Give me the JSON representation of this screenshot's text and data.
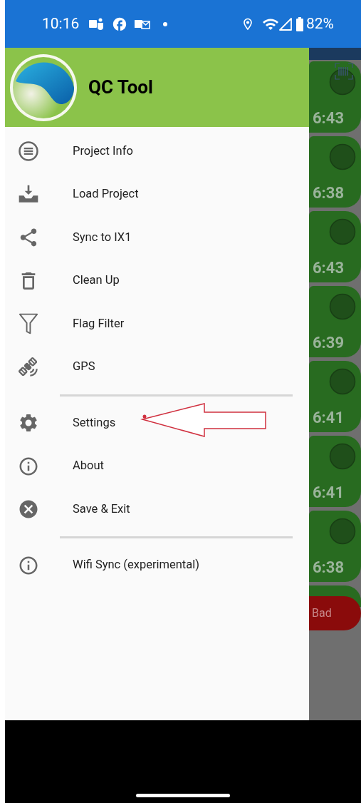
{
  "status_bar": {
    "time": "10:16",
    "battery": "82%"
  },
  "drawer": {
    "title": "QC Tool",
    "menu_sections": [
      [
        {
          "label": "Project Info"
        },
        {
          "label": "Load Project"
        },
        {
          "label": "Sync to IX1"
        },
        {
          "label": "Clean Up"
        },
        {
          "label": "Flag Filter"
        },
        {
          "label": "GPS"
        }
      ],
      [
        {
          "label": "Settings"
        },
        {
          "label": "About"
        },
        {
          "label": "Save & Exit"
        }
      ],
      [
        {
          "label": "Wifi Sync (experimental)"
        }
      ]
    ]
  },
  "background_list": {
    "cards": [
      {
        "time": "6:43"
      },
      {
        "time": "6:38"
      },
      {
        "time": "6:43"
      },
      {
        "time": "6:39"
      },
      {
        "time": "6:41"
      },
      {
        "time": "6:41"
      },
      {
        "time": "6:38"
      }
    ],
    "button": "Bad"
  }
}
